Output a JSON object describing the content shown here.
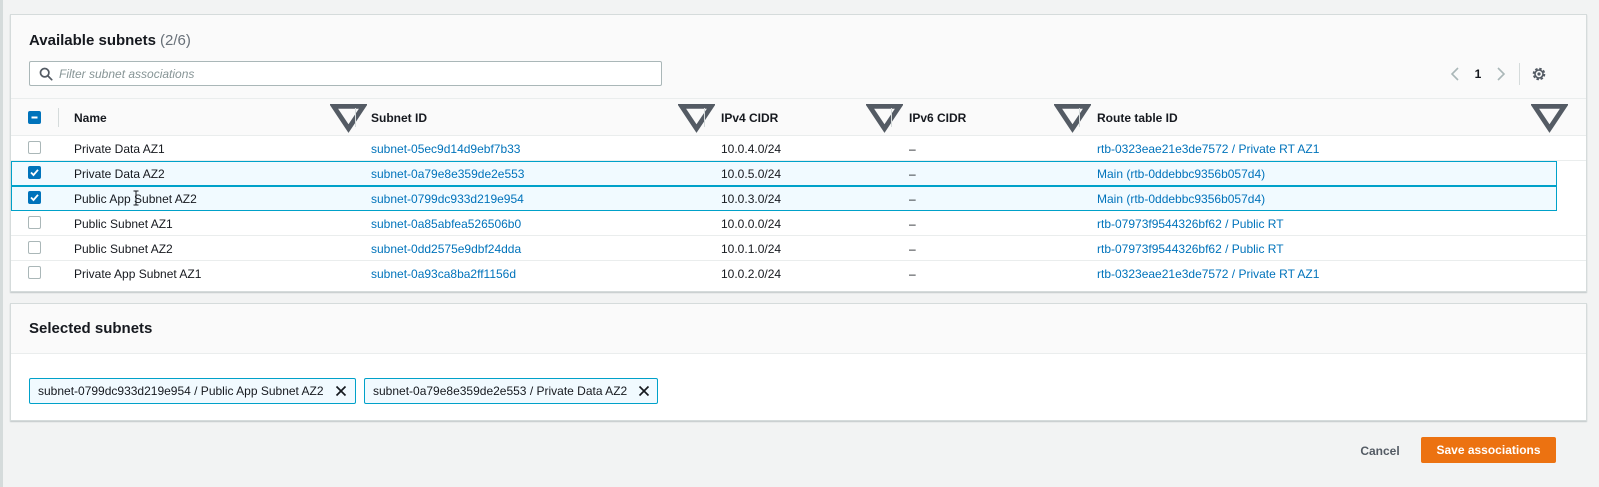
{
  "available": {
    "title": "Available subnets",
    "count": "(2/6)",
    "filter_placeholder": "Filter subnet associations",
    "page": "1",
    "columns": [
      "Name",
      "Subnet ID",
      "IPv4 CIDR",
      "IPv6 CIDR",
      "Route table ID"
    ],
    "rows": [
      {
        "name": "Private Data AZ1",
        "subnet_id": "subnet-05ec9d14d9ebf7b33",
        "ipv4": "10.0.4.0/24",
        "ipv6": "–",
        "route": "rtb-0323eae21e3de7572 / Private RT AZ1",
        "checked": false
      },
      {
        "name": "Private Data AZ2",
        "subnet_id": "subnet-0a79e8e359de2e553",
        "ipv4": "10.0.5.0/24",
        "ipv6": "–",
        "route": "Main (rtb-0ddebbc9356b057d4)",
        "checked": true
      },
      {
        "name": "Public App Subnet AZ2",
        "subnet_id": "subnet-0799dc933d219e954",
        "ipv4": "10.0.3.0/24",
        "ipv6": "–",
        "route": "Main (rtb-0ddebbc9356b057d4)",
        "checked": true
      },
      {
        "name": "Public Subnet AZ1",
        "subnet_id": "subnet-0a85abfea526506b0",
        "ipv4": "10.0.0.0/24",
        "ipv6": "–",
        "route": "rtb-07973f9544326bf62 / Public RT",
        "checked": false
      },
      {
        "name": "Public Subnet AZ2",
        "subnet_id": "subnet-0dd2575e9dbf24dda",
        "ipv4": "10.0.1.0/24",
        "ipv6": "–",
        "route": "rtb-07973f9544326bf62 / Public RT",
        "checked": false
      },
      {
        "name": "Private App Subnet AZ1",
        "subnet_id": "subnet-0a93ca8ba2ff1156d",
        "ipv4": "10.0.2.0/24",
        "ipv6": "–",
        "route": "rtb-0323eae21e3de7572 / Private RT AZ1",
        "checked": false
      }
    ]
  },
  "selected": {
    "title": "Selected subnets",
    "tokens": [
      "subnet-0799dc933d219e954 / Public App Subnet AZ2",
      "subnet-0a79e8e359de2e553 / Private Data AZ2"
    ]
  },
  "actions": {
    "cancel": "Cancel",
    "save": "Save associations"
  },
  "colors": {
    "link": "#0073bb",
    "primary": "#ec7211",
    "selection_border": "#00a1c9",
    "selection_bg": "#f1faff"
  },
  "icons": [
    "search-icon",
    "chevron-left-icon",
    "chevron-right-icon",
    "gear-icon",
    "sort-caret-icon",
    "close-icon",
    "text-cursor-icon"
  ]
}
